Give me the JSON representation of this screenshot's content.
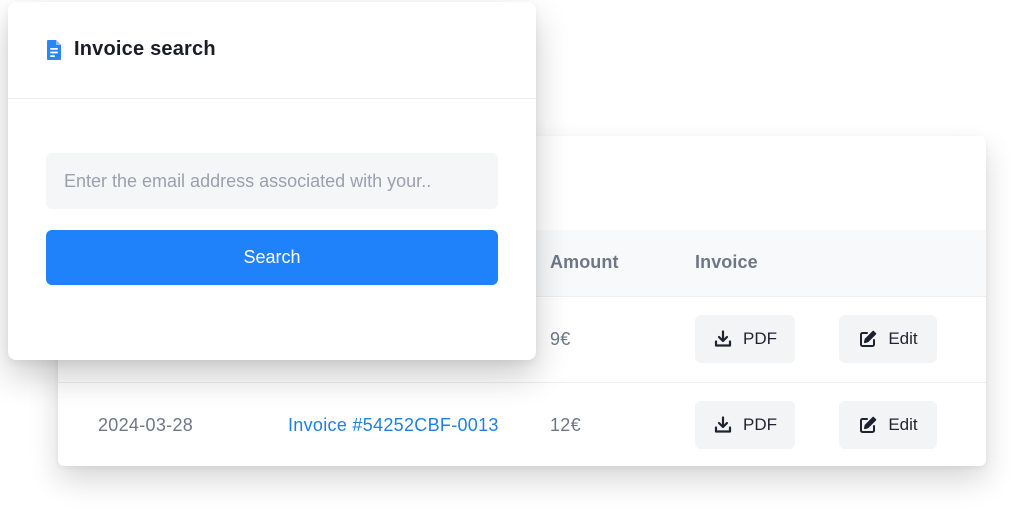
{
  "search_card": {
    "title": "Invoice search",
    "email_placeholder": "Enter the email address associated with your..",
    "search_label": "Search",
    "accent_color": "#1f82fb",
    "title_icon": "document-icon"
  },
  "table": {
    "columns": {
      "amount": "Amount",
      "invoice": "Invoice"
    },
    "rows": [
      {
        "date": "",
        "invoice": "",
        "amount": "9€",
        "pdf_label": "PDF",
        "edit_label": "Edit"
      },
      {
        "date": "2024-03-28",
        "invoice": "Invoice #54252CBF-0013",
        "amount": "12€",
        "pdf_label": "PDF",
        "edit_label": "Edit"
      }
    ],
    "link_color": "#1f7fe5",
    "icons": {
      "pdf": "download-icon",
      "edit": "edit-icon"
    }
  }
}
